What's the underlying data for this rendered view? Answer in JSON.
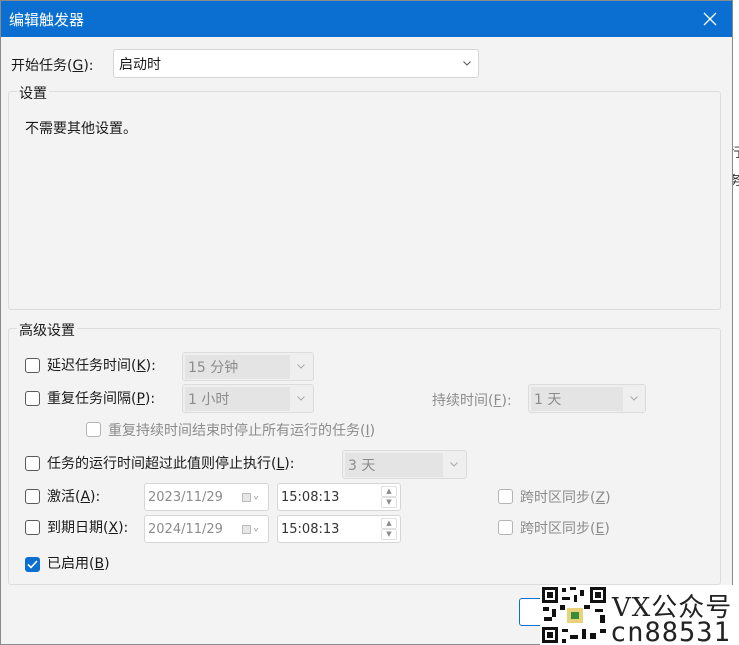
{
  "dialog": {
    "title": "编辑触发器"
  },
  "begin_task": {
    "label": "开始任务(G):",
    "label_pre": "开始任务(",
    "label_key": "G",
    "label_post": "):",
    "value": "启动时"
  },
  "settings": {
    "title": "设置",
    "text": "不需要其他设置。"
  },
  "advanced": {
    "title": "高级设置",
    "delay": {
      "pre": "延迟任务时间(",
      "key": "K",
      "post": "):",
      "value": "15 分钟"
    },
    "repeat": {
      "pre": "重复任务间隔(",
      "key": "P",
      "post": "):",
      "value": "1 小时"
    },
    "duration": {
      "pre": "持续时间(",
      "key": "F",
      "post": "):",
      "value": "1 天"
    },
    "stop_repeat": {
      "pre": "重复持续时间结束时停止所有运行的任务(",
      "key": "I",
      "post": ")"
    },
    "stop_if": {
      "pre": "任务的运行时间超过此值则停止执行(",
      "key": "L",
      "post": "):",
      "value": "3 天"
    },
    "activate": {
      "pre": "激活(",
      "key": "A",
      "post": "):",
      "date": "2023/11/29",
      "time": "15:08:13"
    },
    "expire": {
      "pre": "到期日期(",
      "key": "X",
      "post": "):",
      "date": "2024/11/29",
      "time": "15:08:13"
    },
    "sync_activate": {
      "pre": "跨时区同步(",
      "key": "Z",
      "post": ")"
    },
    "sync_expire": {
      "pre": "跨时区同步(",
      "key": "E",
      "post": ")"
    },
    "enabled": {
      "pre": "已启用(",
      "key": "B",
      "post": ")",
      "checked": true
    }
  },
  "background_fragments": [
    "-",
    "行",
    "务"
  ],
  "watermark": {
    "line1": "VX公众号",
    "line2": "cn88531"
  },
  "colors": {
    "accent": "#0a6fd1",
    "window_bg": "#f3f3f3",
    "disabled_text": "#8c8c8c"
  }
}
